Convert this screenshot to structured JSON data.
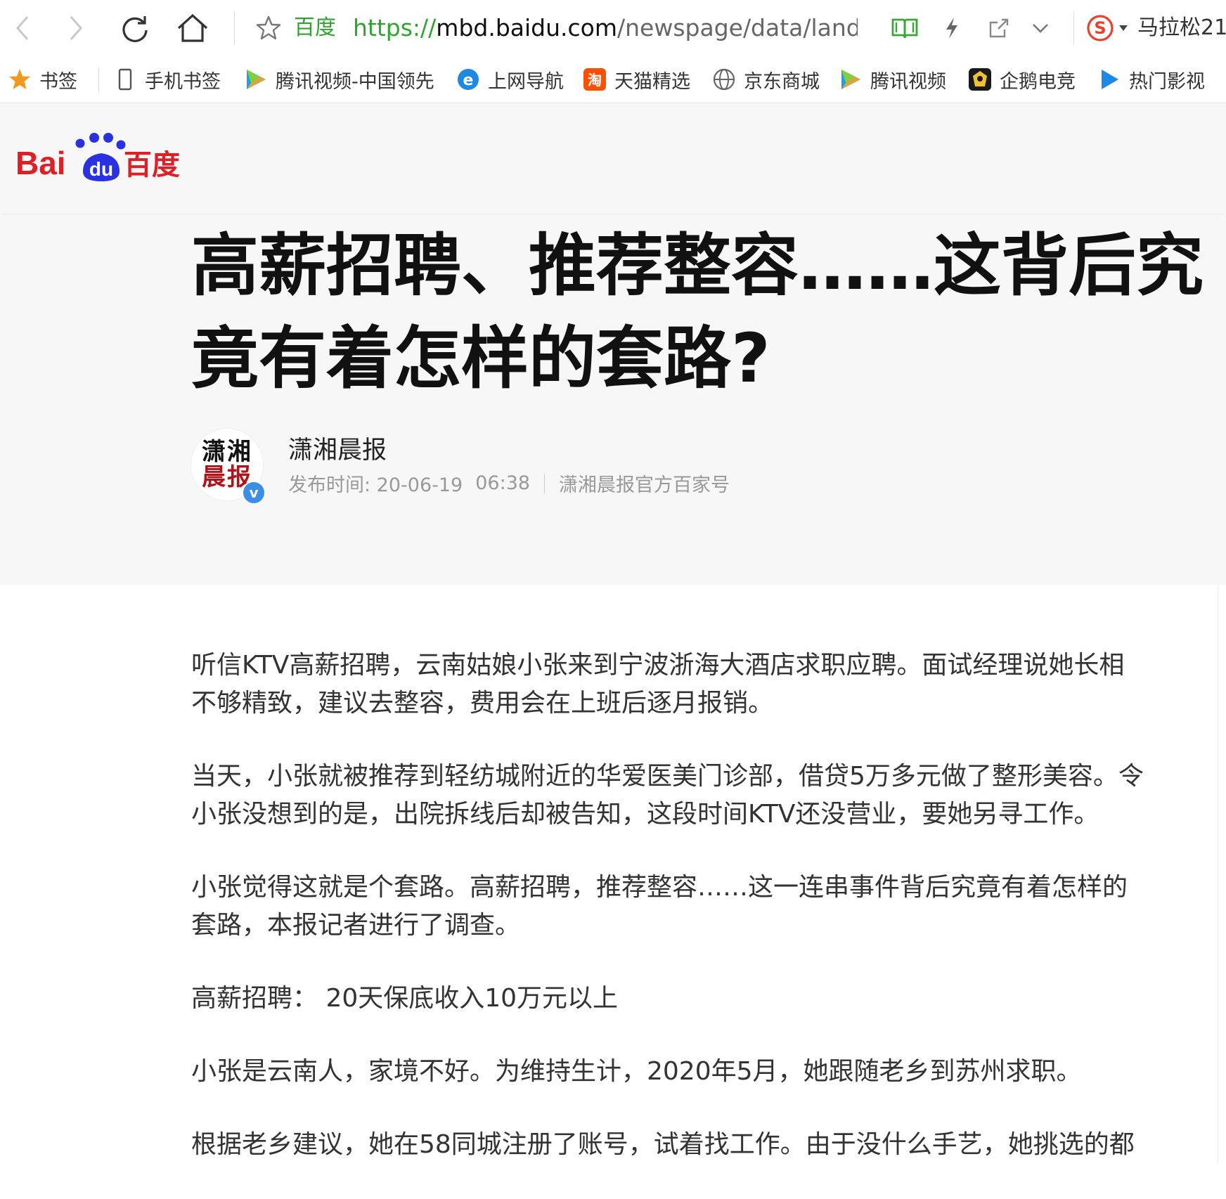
{
  "browser": {
    "address_site_label": "百度",
    "url_protocol": "https://",
    "url_host": "mbd.baidu.com",
    "url_path": "/newspage/data/landing",
    "user_label": "马拉松21"
  },
  "bookmarks": [
    {
      "label": "书签",
      "icon": "star-icon"
    },
    {
      "label": "手机书签",
      "icon": "phone-icon"
    },
    {
      "label": "腾讯视频-中国领先",
      "icon": "tencent-video-icon"
    },
    {
      "label": "上网导航",
      "icon": "ie-icon"
    },
    {
      "label": "天猫精选",
      "icon": "taobao-icon"
    },
    {
      "label": "京东商城",
      "icon": "globe-icon"
    },
    {
      "label": "腾讯视频",
      "icon": "tencent-video-icon"
    },
    {
      "label": "企鹅电竞",
      "icon": "penguin-esports-icon"
    },
    {
      "label": "热门影视",
      "icon": "play-icon"
    }
  ],
  "page": {
    "logo_text": "Bai du 百度",
    "title": "高薪招聘、推荐整容……这背后究竟有着怎样的套路?",
    "author": {
      "avatar_top": "潇湘",
      "avatar_bottom": "晨报",
      "name": "潇湘晨报",
      "publish_label": "发布时间: 20-06-19",
      "publish_time": "06:38",
      "source": "潇湘晨报官方百家号"
    },
    "paragraphs": [
      "听信KTV高薪招聘，云南姑娘小张来到宁波浙海大酒店求职应聘。面试经理说她长相不够精致，建议去整容，费用会在上班后逐月报销。",
      "当天，小张就被推荐到轻纺城附近的华爱医美门诊部，借贷5万多元做了整形美容。令小张没想到的是，出院拆线后却被告知，这段时间KTV还没营业，要她另寻工作。",
      "小张觉得这就是个套路。高薪招聘，推荐整容……这一连串事件背后究竟有着怎样的套路，本报记者进行了调查。",
      "高薪招聘： 20天保底收入10万元以上",
      "小张是云南人，家境不好。为维持生计，2020年5月，她跟随老乡到苏州求职。",
      "根据老乡建议，她在58同城注册了账号，试着找工作。由于没什么手艺，她挑选的都"
    ]
  },
  "colors": {
    "accent_green": "#2fa52f",
    "baidu_red": "#de1f26",
    "baidu_blue": "#2932e1",
    "verified_blue": "#3a8ee6"
  }
}
